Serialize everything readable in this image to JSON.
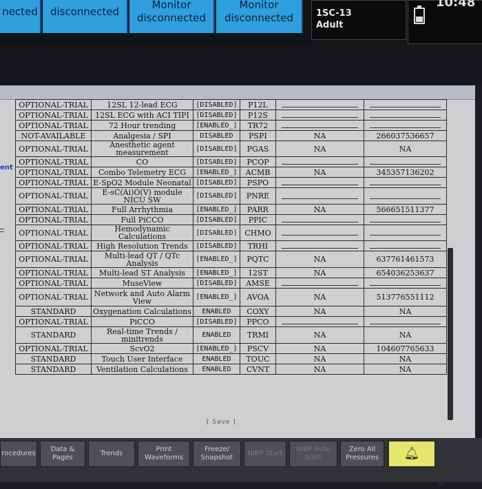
{
  "header": {
    "tiles": [
      {
        "line1": "",
        "line2": "nected"
      },
      {
        "line1": "",
        "line2": "disconnected"
      },
      {
        "line1": "Monitor",
        "line2": "disconnected"
      },
      {
        "line1": "Monitor",
        "line2": "disconnected"
      }
    ],
    "patient_bed": "1SC-13",
    "patient_type": "Adult",
    "clock": "10:48"
  },
  "side_fragment": "ent",
  "options_table": {
    "rows": [
      {
        "status": "OPTIONAL-TRIAL",
        "name": "12SL 12-lead ECG",
        "state": "[DISABLED]",
        "code": "P12L",
        "na": "",
        "key": ""
      },
      {
        "status": "OPTIONAL-TRIAL",
        "name": "12SL ECG with ACI TIPI",
        "state": "[DISABLED]",
        "code": "P12S",
        "na": "",
        "key": ""
      },
      {
        "status": "OPTIONAL-TRIAL",
        "name": "72 Hour trending",
        "state": "[ENABLED_]",
        "code": "TR72",
        "na": "",
        "key": ""
      },
      {
        "status": "NOT-AVAILABLE",
        "name": "Analgesia / SPI",
        "state": "DISABLED",
        "code": "PSPI",
        "na": "NA",
        "key": "266037536657"
      },
      {
        "status": "OPTIONAL-TRIAL",
        "name": "Anesthetic agent measurement",
        "state": "[DISABLED]",
        "code": "PGAS",
        "na": "NA",
        "key": "NA"
      },
      {
        "status": "OPTIONAL-TRIAL",
        "name": "CO",
        "state": "[DISABLED]",
        "code": "PCOP",
        "na": "",
        "key": ""
      },
      {
        "status": "OPTIONAL-TRIAL",
        "name": "Combo Telemetry ECG",
        "state": "[ENABLED_]",
        "code": "ACMB",
        "na": "NA",
        "key": "345357136202"
      },
      {
        "status": "OPTIONAL-TRIAL",
        "name": "E-SpO2 Module Neonatal",
        "state": "[DISABLED]",
        "code": "PSPO",
        "na": "",
        "key": ""
      },
      {
        "status": "OPTIONAL-TRIAL",
        "name": "E-sC(Ai)O(V) module NICU SW",
        "state": "[DISABLED]",
        "code": "PNRE",
        "na": "",
        "key": ""
      },
      {
        "status": "OPTIONAL-TRIAL",
        "name": "Full Arrhythmia",
        "state": "[ENABLED_]",
        "code": "PARR",
        "na": "NA",
        "key": "566651511377"
      },
      {
        "status": "OPTIONAL-TRIAL",
        "name": "Full PiCCO",
        "state": "[DISABLED]",
        "code": "PPIC",
        "na": "",
        "key": ""
      },
      {
        "status": "OPTIONAL-TRIAL",
        "name": "Hemodynamic Calculations",
        "state": "[DISABLED]",
        "code": "CHMO",
        "na": "",
        "key": ""
      },
      {
        "status": "OPTIONAL-TRIAL",
        "name": "High Resolution Trends",
        "state": "[DISABLED]",
        "code": "TRHI",
        "na": "",
        "key": ""
      },
      {
        "status": "OPTIONAL-TRIAL",
        "name": "Multi-lead QT / QTc Analysis",
        "state": "[ENABLED_]",
        "code": "PQTC",
        "na": "NA",
        "key": "637761461573"
      },
      {
        "status": "OPTIONAL-TRIAL",
        "name": "Multi-lead ST Analysis",
        "state": "[ENABLED_]",
        "code": "12ST",
        "na": "NA",
        "key": "654036253637"
      },
      {
        "status": "OPTIONAL-TRIAL",
        "name": "MuseView",
        "state": "[DISABLED]",
        "code": "AMSE",
        "na": "",
        "key": ""
      },
      {
        "status": "OPTIONAL-TRIAL",
        "name": "Network and Auto Alarm View",
        "state": "[ENABLED_]",
        "code": "AVOA",
        "na": "NA",
        "key": "513776551112"
      },
      {
        "status": "STANDARD",
        "name": "Oxygenation Calculations",
        "state": "ENABLED",
        "code": "COXY",
        "na": "NA",
        "key": "NA"
      },
      {
        "status": "OPTIONAL-TRIAL",
        "name": "PiCCO",
        "state": "[DISABLED]",
        "code": "PPCO",
        "na": "",
        "key": ""
      },
      {
        "status": "STANDARD",
        "name": "Real-time Trends / minitrends",
        "state": "ENABLED",
        "code": "TRMI",
        "na": "NA",
        "key": "NA"
      },
      {
        "status": "OPTIONAL-TRIAL",
        "name": "ScvO2",
        "state": "[ENABLED_]",
        "code": "PSCV",
        "na": "NA",
        "key": "104607765633"
      },
      {
        "status": "STANDARD",
        "name": "Touch User Interface",
        "state": "ENABLED",
        "code": "TOUC",
        "na": "NA",
        "key": "NA"
      },
      {
        "status": "STANDARD",
        "name": "Ventilation Calculations",
        "state": "ENABLED",
        "code": "CVNT",
        "na": "NA",
        "key": "NA"
      }
    ]
  },
  "save_label": "[ Save ]",
  "bottom_keys": [
    {
      "label": "rocedures",
      "disabled": false
    },
    {
      "label": "Data & Pages",
      "disabled": false
    },
    {
      "label": "Trends",
      "disabled": false
    },
    {
      "label": "Print Waveforms",
      "disabled": false
    },
    {
      "label": "Freeze/ Snapshot",
      "disabled": false
    },
    {
      "label": "NIBP Start",
      "disabled": true
    },
    {
      "label": "NIBP Auto Start",
      "disabled": true
    },
    {
      "label": "Zero All Pressures",
      "disabled": false
    }
  ],
  "icons": {
    "alarm": "bell-icon",
    "battery": "battery-icon",
    "close": "close-icon"
  },
  "colors": {
    "tile_blue": "#2f9fe0",
    "alarm_key": "#e6e66a"
  }
}
